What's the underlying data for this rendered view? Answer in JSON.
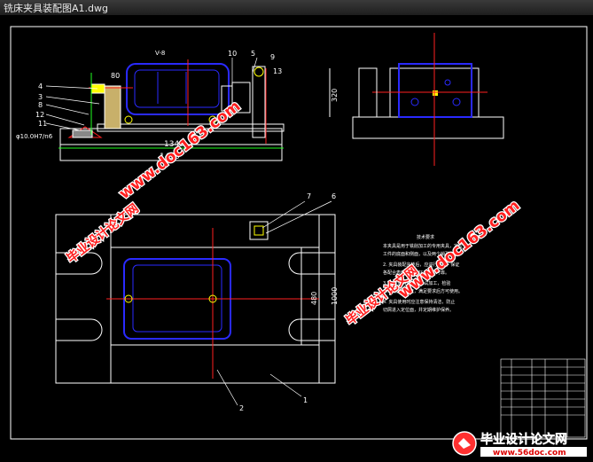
{
  "window": {
    "title": "铣床夹具装配图A1.dwg"
  },
  "drawing": {
    "part_labels": [
      "4",
      "80",
      "3",
      "8",
      "12",
      "11",
      "10",
      "5",
      "9",
      "13",
      "7",
      "6",
      "2",
      "1"
    ],
    "dims": {
      "d1340": "1340",
      "d1450": "1450",
      "d320": "320",
      "d480": "480",
      "d1000": "1000",
      "phi": "φ10.0H7/n6",
      "tag": "V-8"
    },
    "notes_title": "技术要求",
    "notes": [
      "本夹具是用于铣削加工的专用夹具，定位",
      "工件的底面和侧面，以及两个销孔定位",
      "2. 夹具装配完毕后，应进行检验，保证",
      "各配合表面接触良好，夹紧可靠。",
      "3. 夹具使用前应进行试加工，检验",
      "工件的加工精度，满足要求后方可使用。",
      "4. 夹具使用时应注意保持清洁，防止",
      "切屑进入定位面，并定期维护保养。"
    ]
  },
  "watermarks": {
    "url": "www.doc163.com",
    "cn": "毕业设计论文网",
    "url2": "www.56doc.com"
  },
  "colors": {
    "frame": "#ffffff",
    "blue": "#2a2aff",
    "red": "#ff2020",
    "green": "#20ff20",
    "yellow": "#ffff00",
    "cyan": "#00ffff"
  }
}
